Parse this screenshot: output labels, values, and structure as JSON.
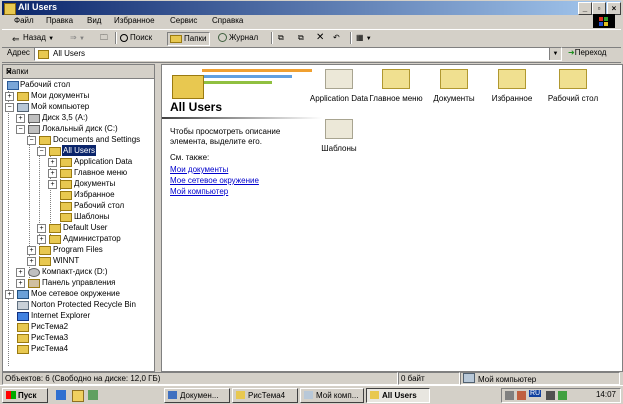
{
  "window": {
    "title": "All Users"
  },
  "menu": [
    "Файл",
    "Правка",
    "Вид",
    "Избранное",
    "Сервис",
    "Справка"
  ],
  "toolbar": {
    "back": "Назад",
    "search": "Поиск",
    "folders": "Папки",
    "history": "Журнал"
  },
  "address": {
    "label": "Адрес",
    "value": "All Users",
    "go": "Переход"
  },
  "folders_pane": {
    "title": "Папки",
    "tree": [
      "Рабочий стол",
      "Мои документы",
      "Мой компьютер",
      "Диск 3,5 (A:)",
      "Локальный диск (C:)",
      "Documents and Settings",
      "All Users",
      "Application Data",
      "Главное меню",
      "Документы",
      "Избранное",
      "Рабочий стол",
      "Шаблоны",
      "Default User",
      "Администратор",
      "Program Files",
      "WINNT",
      "Компакт-диск (D:)",
      "Панель управления",
      "Мое сетевое окружение",
      "Norton Protected Recycle Bin",
      "Internet Explorer",
      "РисТема2",
      "РисТема3",
      "РисТема4"
    ]
  },
  "content": {
    "title": "All Users",
    "description": "Чтобы просмотреть описание элемента, выделите его.",
    "see_also": "См. также:",
    "links": [
      "Мои документы",
      "Мое сетевое окружение",
      "Мой компьютер"
    ],
    "items": [
      "Application Data",
      "Главное меню",
      "Документы",
      "Избранное",
      "Рабочий стол",
      "Шаблоны"
    ]
  },
  "status": {
    "objects": "Объектов: 6 (Свободно на диске: 12,0 ГБ)",
    "size": "0 байт",
    "location": "Мой компьютер"
  },
  "taskbar": {
    "start": "Пуск",
    "tasks": [
      "Докумен...",
      "РисТема4",
      "Мой комп...",
      "All Users"
    ],
    "lang": "RU",
    "clock": "14:07"
  }
}
